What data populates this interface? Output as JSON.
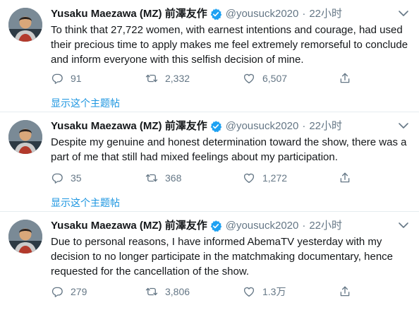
{
  "tweets": [
    {
      "name": "Yusaku Maezawa (MZ) 前澤友作",
      "handle": "@yousuck2020",
      "separator": "·",
      "time": "22小时",
      "text": "To think that 27,722 women, with earnest intentions and courage, had used their precious time to apply makes me feel extremely remorseful to conclude and inform everyone with this selfish decision of mine.",
      "replies": "91",
      "retweets": "2,332",
      "likes": "6,507",
      "show_thread": "显示这个主题帖"
    },
    {
      "name": "Yusaku Maezawa (MZ) 前澤友作",
      "handle": "@yousuck2020",
      "separator": "·",
      "time": "22小时",
      "text": "Despite my genuine and honest determination toward the show, there was a part of me that still had mixed feelings about my participation.",
      "replies": "35",
      "retweets": "368",
      "likes": "1,272",
      "show_thread": "显示这个主题帖"
    },
    {
      "name": "Yusaku Maezawa (MZ) 前澤友作",
      "handle": "@yousuck2020",
      "separator": "·",
      "time": "22小时",
      "text": "Due to personal reasons, I have informed AbemaTV yesterday with my decision to no longer participate in the matchmaking documentary, hence requested for the cancellation of the show.",
      "replies": "279",
      "retweets": "3,806",
      "likes": "1.3万"
    }
  ],
  "colors": {
    "accent": "#1b95e0",
    "verified": "#1da1f2",
    "muted": "#657786",
    "divider": "#e6ecf0"
  },
  "icons": [
    "verified-badge-icon",
    "chevron-down-icon",
    "reply-icon",
    "retweet-icon",
    "like-icon",
    "share-icon"
  ]
}
